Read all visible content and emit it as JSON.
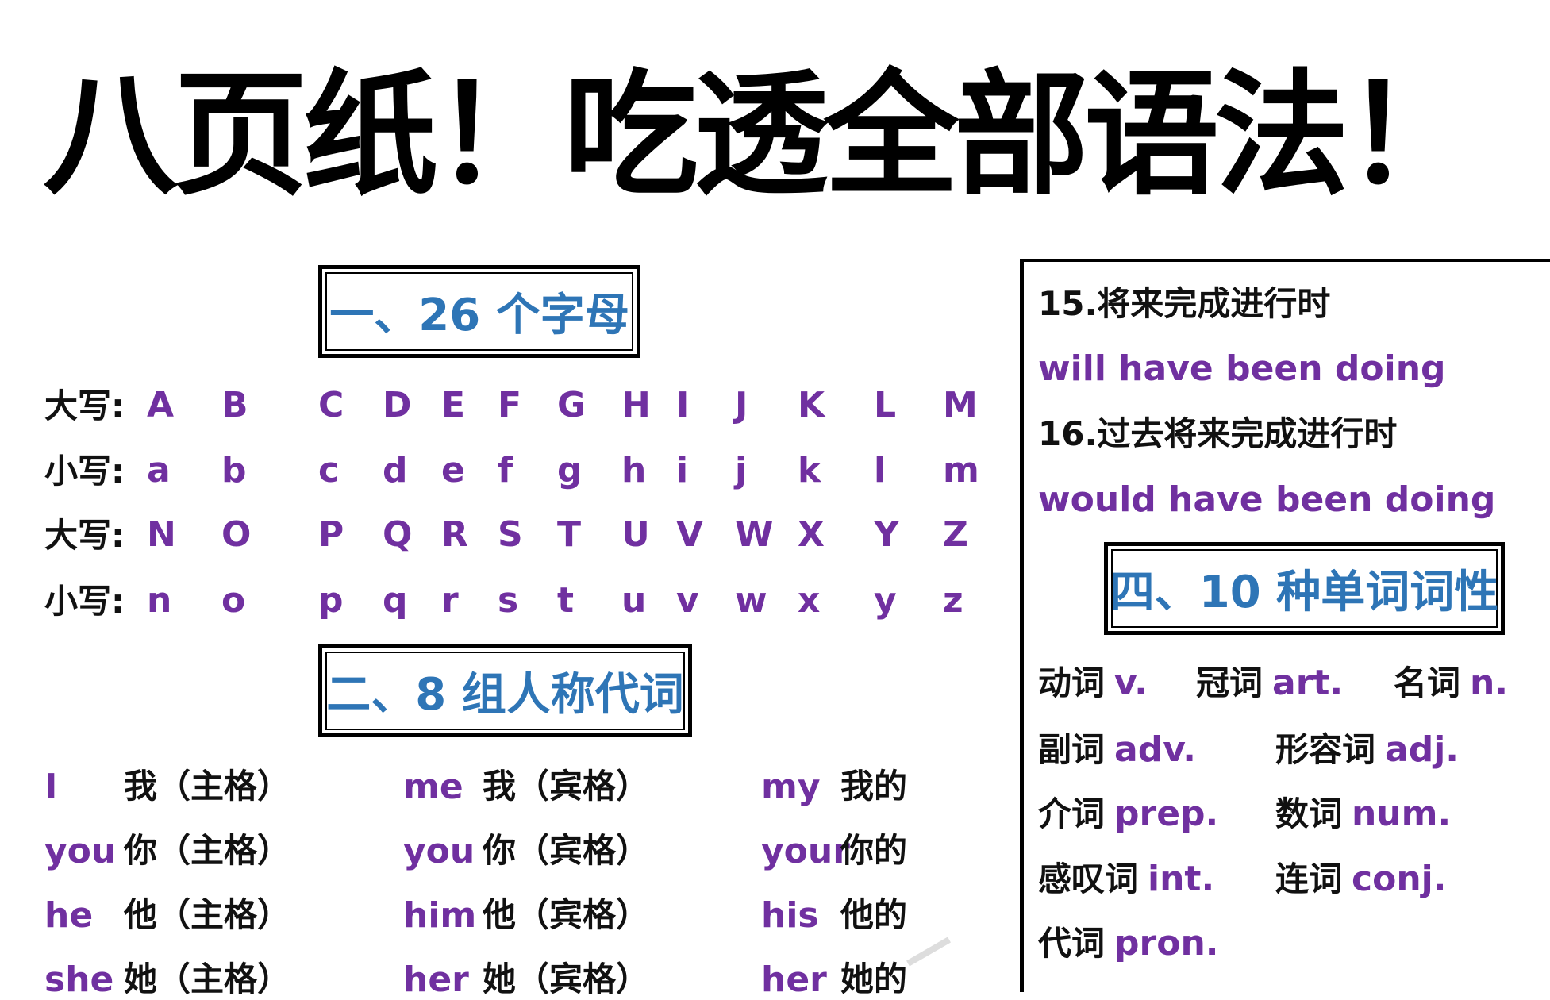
{
  "title": "八页纸！吃透全部语法！",
  "colors": {
    "heading": "#2e75b6",
    "english": "#7030a0",
    "text": "#111111"
  },
  "section1": {
    "heading": "一、26 个字母",
    "rows": [
      {
        "label": "大写:",
        "letters": [
          "A",
          "B",
          "C",
          "D",
          "E",
          "F",
          "G",
          "H",
          "I",
          "J",
          "K",
          "L",
          "M"
        ]
      },
      {
        "label": "小写:",
        "letters": [
          "a",
          "b",
          "c",
          "d",
          "e",
          "f",
          "g",
          "h",
          "i",
          "j",
          "k",
          "l",
          "m"
        ]
      },
      {
        "label": "大写:",
        "letters": [
          "N",
          "O",
          "P",
          "Q",
          "R",
          "S",
          "T",
          "U",
          "V",
          "W",
          "X",
          "Y",
          "Z"
        ]
      },
      {
        "label": "小写:",
        "letters": [
          "n",
          "o",
          "p",
          "q",
          "r",
          "s",
          "t",
          "u",
          "v",
          "w",
          "x",
          "y",
          "z"
        ]
      }
    ]
  },
  "section2": {
    "heading": "二、8 组人称代词",
    "rows": [
      {
        "subj": "I",
        "subj_cn": "我（主格）",
        "obj": "me",
        "obj_cn": "我（宾格）",
        "poss": "my",
        "poss_cn": "我的"
      },
      {
        "subj": "you",
        "subj_cn": "你（主格）",
        "obj": "you",
        "obj_cn": "你（宾格）",
        "poss": "your",
        "poss_cn": "你的"
      },
      {
        "subj": "he",
        "subj_cn": "他（主格）",
        "obj": "him",
        "obj_cn": "他（宾格）",
        "poss": "his",
        "poss_cn": "他的"
      },
      {
        "subj": "she",
        "subj_cn": "她（主格）",
        "obj": "her",
        "obj_cn": "她（宾格）",
        "poss": "her",
        "poss_cn": "她的"
      }
    ]
  },
  "tenses": [
    {
      "name": "15.将来完成进行时",
      "form": "will have been doing"
    },
    {
      "name": "16.过去将来完成进行时",
      "form": "would have been doing"
    }
  ],
  "section4": {
    "heading": "四、10 种单词词性",
    "items": [
      {
        "cn": "动词",
        "en": "v."
      },
      {
        "cn": "冠词",
        "en": "art."
      },
      {
        "cn": "名词",
        "en": "n."
      },
      {
        "cn": "副词",
        "en": "adv."
      },
      {
        "cn": "形容词",
        "en": "adj."
      },
      {
        "cn": "介词",
        "en": "prep."
      },
      {
        "cn": "数词",
        "en": "num."
      },
      {
        "cn": "感叹词",
        "en": "int."
      },
      {
        "cn": "连词",
        "en": "conj."
      },
      {
        "cn": "代词",
        "en": "pron."
      }
    ]
  }
}
